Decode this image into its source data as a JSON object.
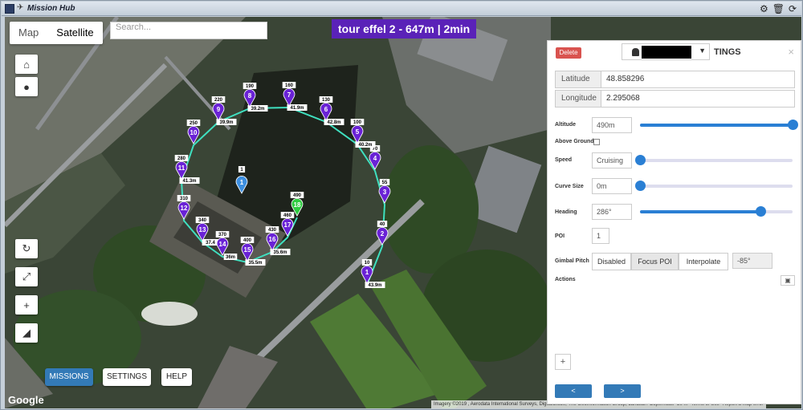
{
  "window": {
    "title": "Mission Hub"
  },
  "map": {
    "type_options": [
      {
        "label": "Map"
      },
      {
        "label": "Satellite"
      }
    ],
    "search_placeholder": "Search...",
    "mission_title": "tour effel 2 - 647m | 2min",
    "attribution": {
      "imagery": "Imagery ©2019 , Aerodata International Surveys, DigitalGlobe, The GeoInformation Group, Landsat / Copernicus",
      "scale": "20 m",
      "terms": "Terms of Use",
      "report": "Report a map error"
    },
    "google_logo": "Google"
  },
  "bottom_nav": [
    {
      "label": "MISSIONS"
    },
    {
      "label": "SETTINGS"
    },
    {
      "label": "HELP"
    }
  ],
  "waypoints": [
    {
      "n": "1",
      "alt": "10",
      "dist": "43.9m"
    },
    {
      "n": "2",
      "alt": "40",
      "dist": ""
    },
    {
      "n": "3",
      "alt": "55",
      "dist": ""
    },
    {
      "n": "4",
      "alt": "70",
      "dist": ""
    },
    {
      "n": "5",
      "alt": "100",
      "dist": "40.2m"
    },
    {
      "n": "6",
      "alt": "130",
      "dist": "42.8m"
    },
    {
      "n": "7",
      "alt": "160",
      "dist": "41.9m"
    },
    {
      "n": "8",
      "alt": "190",
      "dist": "39.2m"
    },
    {
      "n": "9",
      "alt": "220",
      "dist": "39.9m"
    },
    {
      "n": "10",
      "alt": "250",
      "dist": ""
    },
    {
      "n": "11",
      "alt": "280",
      "dist": "41.3m"
    },
    {
      "n": "12",
      "alt": "310",
      "dist": ""
    },
    {
      "n": "13",
      "alt": "340",
      "dist": "37.4"
    },
    {
      "n": "14",
      "alt": "370",
      "dist": "36m"
    },
    {
      "n": "15",
      "alt": "400",
      "dist": "35.5m"
    },
    {
      "n": "16",
      "alt": "430",
      "dist": "35.6m"
    },
    {
      "n": "17",
      "alt": "460",
      "dist": ""
    },
    {
      "n": "18",
      "alt": "490",
      "dist": ""
    }
  ],
  "poi": {
    "n": "1",
    "label": "1"
  },
  "colors": {
    "waypoint": "#6a22d6",
    "selected_waypoint": "#2ecc40",
    "poi": "#3d8fe0",
    "path": "#3fe0c0",
    "accent": "#337ab7"
  },
  "panel": {
    "delete_label": "Delete",
    "title": "TINGS",
    "close": "×",
    "latitude_label": "Latitude",
    "latitude": "48.858296",
    "longitude_label": "Longitude",
    "longitude": "2.295068",
    "altitude_label": "Altitude",
    "altitude": "490m",
    "altitude_fraction": 1.0,
    "above_ground_label": "Above Ground",
    "speed_label": "Speed",
    "speed": "Cruising",
    "speed_fraction": 0.0,
    "curve_label": "Curve Size",
    "curve": "0m",
    "curve_fraction": 0.0,
    "heading_label": "Heading",
    "heading": "286°",
    "heading_fraction": 0.79,
    "poi_label": "POI",
    "poi_value": "1",
    "gimbal_label": "Gimbal Pitch",
    "gimbal_options": [
      "Disabled",
      "Focus POI",
      "Interpolate"
    ],
    "gimbal_value": "-85°",
    "actions_label": "Actions",
    "add_label": "+",
    "prev_label": "<",
    "next_label": ">"
  },
  "map_controls": {
    "zoom_in": "+",
    "zoom_out": "−"
  }
}
